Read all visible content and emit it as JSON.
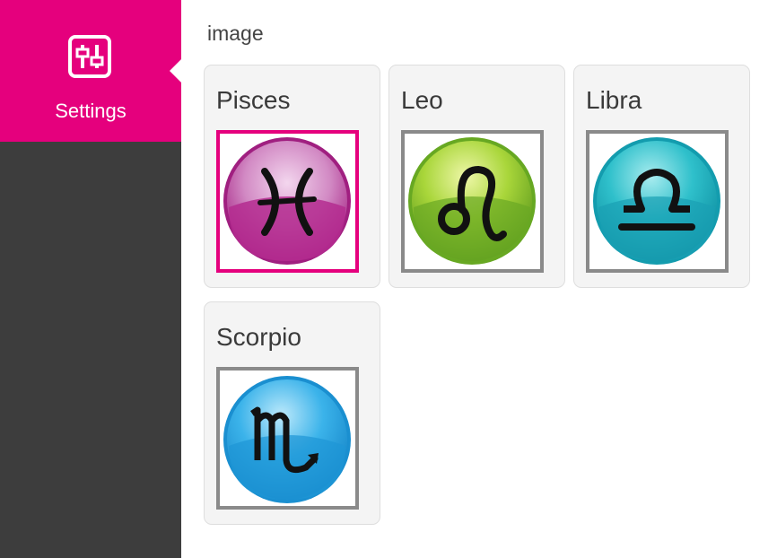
{
  "sidebar": {
    "items": [
      {
        "label": "Settings",
        "icon": "sliders-icon",
        "active": true
      }
    ]
  },
  "main": {
    "section_label": "image",
    "cards": [
      {
        "title": "Pisces",
        "icon": "pisces-icon",
        "color": "#b8238f",
        "selected": true
      },
      {
        "title": "Leo",
        "icon": "leo-icon",
        "color": "#7fbf2a",
        "selected": false
      },
      {
        "title": "Libra",
        "icon": "libra-icon",
        "color": "#16aab8",
        "selected": false
      },
      {
        "title": "Scorpio",
        "icon": "scorpio-icon",
        "color": "#1fa0dc",
        "selected": false
      }
    ]
  },
  "colors": {
    "accent": "#e5007d",
    "sidebar_bg": "#3d3d3d"
  }
}
